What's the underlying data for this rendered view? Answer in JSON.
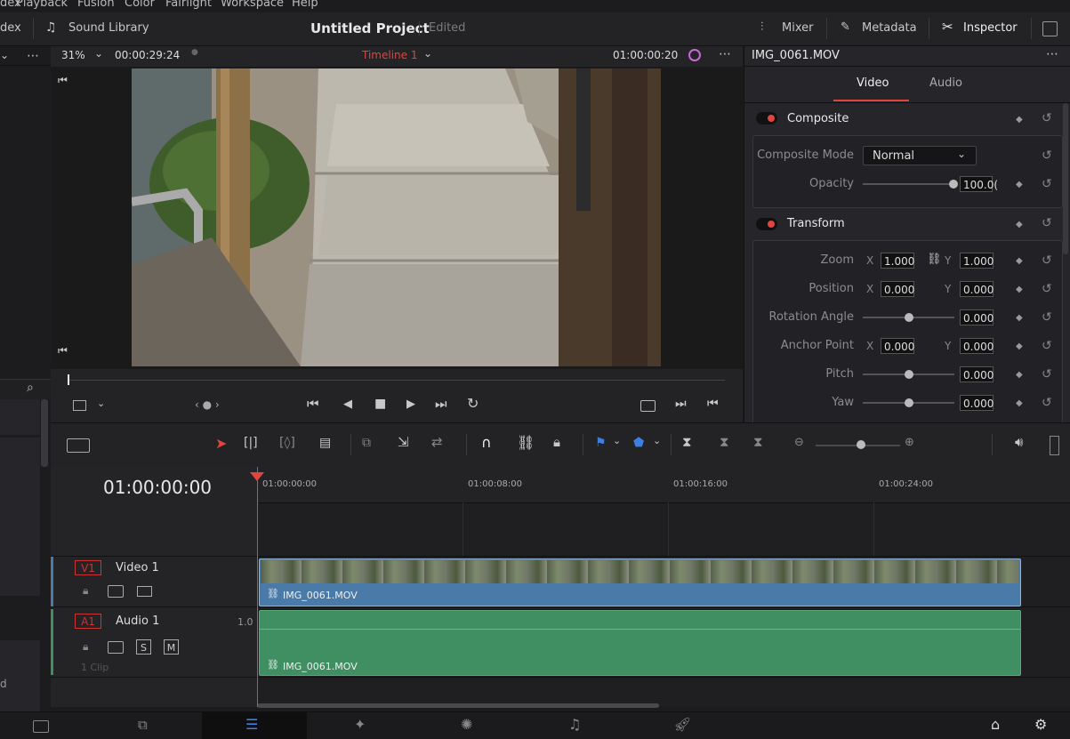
{
  "menu": [
    "dex",
    "Playback",
    "Fusion",
    "Color",
    "Fairlight",
    "Workspace",
    "Help"
  ],
  "header": {
    "index_label": "dex",
    "sound_library": "Sound Library",
    "project_title": "Untitled Project",
    "project_status": "Edited",
    "mixer": "Mixer",
    "metadata": "Metadata",
    "inspector": "Inspector"
  },
  "viewer": {
    "zoom": "31%",
    "duration": "00:00:29:24",
    "timeline_name": "Timeline 1",
    "timecode": "01:00:00:20"
  },
  "inspector": {
    "clip_name": "IMG_0061.MOV",
    "tabs": [
      "Video",
      "Audio"
    ],
    "active_tab": "Video",
    "composite": {
      "title": "Composite",
      "mode_label": "Composite Mode",
      "mode_value": "Normal",
      "opacity_label": "Opacity",
      "opacity_value": "100.0("
    },
    "transform": {
      "title": "Transform",
      "zoom_label": "Zoom",
      "zoom_x": "1.000",
      "zoom_y": "1.000",
      "position_label": "Position",
      "position_x": "0.000",
      "position_y": "0.000",
      "rotation_label": "Rotation Angle",
      "rotation_value": "0.000",
      "anchor_label": "Anchor Point",
      "anchor_x": "0.000",
      "anchor_y": "0.000",
      "pitch_label": "Pitch",
      "pitch_value": "0.000",
      "yaw_label": "Yaw",
      "yaw_value": "0.000",
      "x_label": "X",
      "y_label": "Y"
    }
  },
  "timeline": {
    "current_timecode": "01:00:00:00",
    "ruler": [
      "01:00:00:00",
      "01:00:08:00",
      "01:00:16:00",
      "01:00:24:00"
    ],
    "video_track": {
      "id": "V1",
      "name": "Video 1",
      "clip": "IMG_0061.MOV"
    },
    "audio_track": {
      "id": "A1",
      "name": "Audio 1",
      "level": "1.0",
      "clip": "IMG_0061.MOV",
      "clip_count": "1 Clip",
      "solo": "S",
      "mute": "M"
    }
  },
  "left_panel": {
    "partial_text": "d"
  },
  "colors": {
    "accent_red": "#e0453f",
    "video_clip": "#4a7aa8",
    "audio_clip": "#3f8f62",
    "playhead": "#e0453f",
    "active_page": "#0f0f10"
  }
}
